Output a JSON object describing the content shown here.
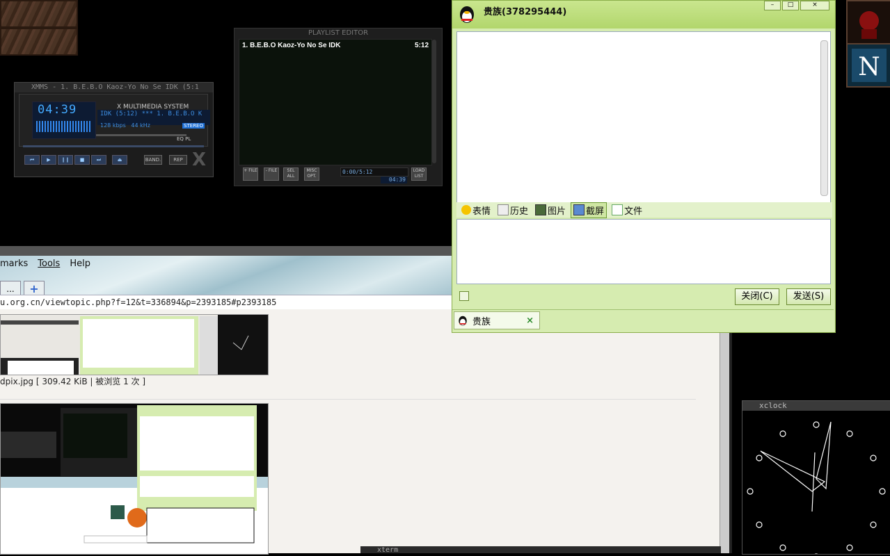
{
  "xmms": {
    "title": "XMMS - 1. B.E.B.O Kaoz-Yo No Se IDK (5:1",
    "time": "04:39",
    "system_label": "X MULTIMEDIA SYSTEM",
    "song_scroll": "IDK (5:12)  ***  1. B.E.B.O K",
    "bitrate": "128 kbps   44 kHz",
    "stereo_label": "STEREO",
    "eq_pl": "EQ  PL",
    "band_label": "BAND.",
    "rep_label": "REP"
  },
  "playlist": {
    "title": "PLAYLIST EDITOR",
    "items": [
      {
        "name": "1. B.E.B.O Kaoz-Yo No Se IDK",
        "length": "5:12"
      }
    ],
    "buttons": [
      "+ FILE",
      "- FILE",
      "SEL ALL",
      "MISC OPT.",
      "LOAD LIST"
    ],
    "time_display": "0:00/5:12",
    "time_small": "04:39"
  },
  "browser": {
    "menu": [
      "marks",
      "Tools",
      "Help"
    ],
    "url": "u.org.cn/viewtopic.php?f=12&t=336894&p=2393185#p2393185",
    "caption": "dpix.jpg [ 309.42 KiB | 被浏览 1 次 ]",
    "tab_ellipsis": "...",
    "new_tab": "+"
  },
  "qq": {
    "contact_title": "贵族(378295444)",
    "tools": [
      "表情",
      "历史",
      "图片",
      "截屏",
      "文件"
    ],
    "close_button": "关闭(C)",
    "send_button": "发送(S)",
    "tab_name": "贵族",
    "tab_close": "×",
    "minimize": "–",
    "maximize": "□",
    "close": "×"
  },
  "xclock": {
    "title": "xclock"
  },
  "xterm": {
    "title": "xterm"
  },
  "colors": {
    "qq_green": "#d6ecb0",
    "xmms_blue": "#3d8de0"
  }
}
